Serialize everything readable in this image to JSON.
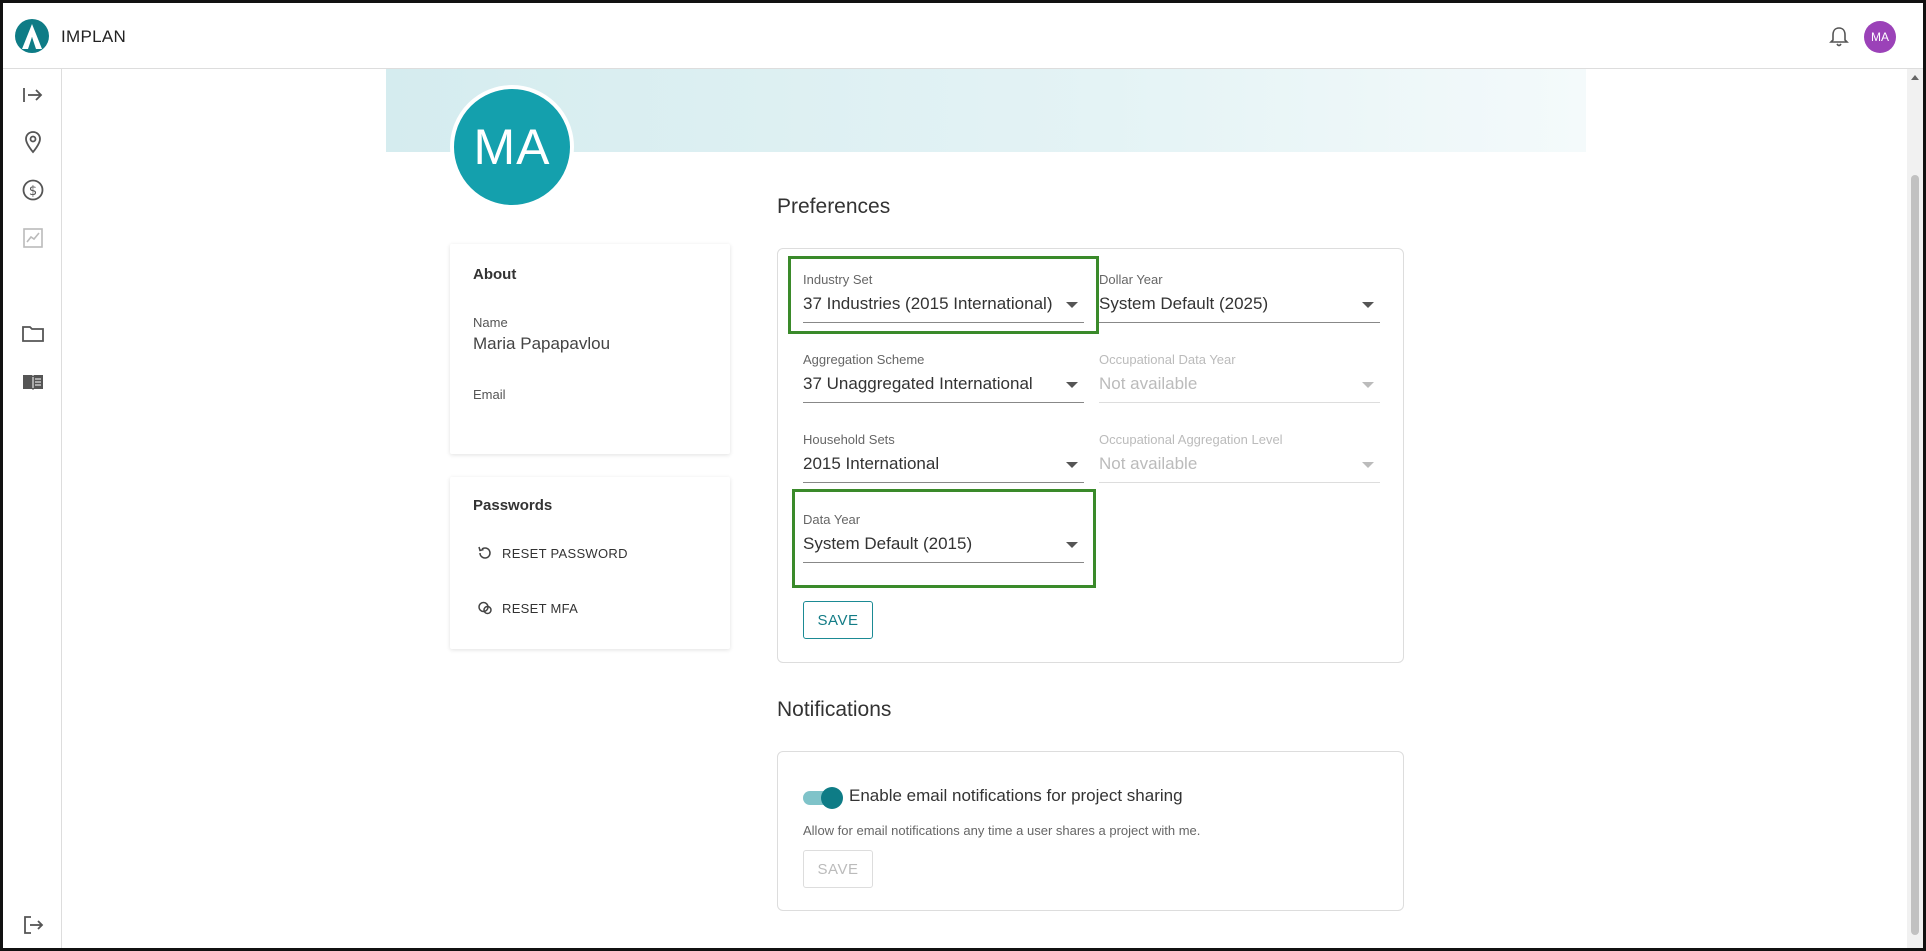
{
  "app": {
    "brand": "IMPLAN",
    "avatar_initials": "MA"
  },
  "sidebar": {
    "items": [
      {
        "icon": "expand-sidebar-icon"
      },
      {
        "icon": "location-pin-icon"
      },
      {
        "icon": "dollar-circle-icon"
      },
      {
        "icon": "chart-icon"
      },
      {
        "icon": "folder-icon"
      },
      {
        "icon": "book-icon"
      },
      {
        "icon": "logout-icon"
      }
    ]
  },
  "profile": {
    "initials": "MA",
    "about": {
      "title": "About",
      "name_label": "Name",
      "name_value": "Maria Papapavlou",
      "email_label": "Email",
      "email_value": ""
    },
    "passwords": {
      "title": "Passwords",
      "reset_password": "RESET PASSWORD",
      "reset_mfa": "RESET MFA"
    }
  },
  "preferences": {
    "title": "Preferences",
    "industry_set": {
      "label": "Industry Set",
      "value": "37 Industries (2015 International)"
    },
    "dollar_year": {
      "label": "Dollar Year",
      "value": "System Default (2025)"
    },
    "aggregation_scheme": {
      "label": "Aggregation Scheme",
      "value": "37 Unaggregated International"
    },
    "occupational_data_year": {
      "label": "Occupational Data Year",
      "value": "Not available"
    },
    "household_sets": {
      "label": "Household Sets",
      "value": "2015 International"
    },
    "occupational_aggregation_level": {
      "label": "Occupational Aggregation Level",
      "value": "Not available"
    },
    "data_year": {
      "label": "Data Year",
      "value": "System Default (2015)"
    },
    "save": "SAVE"
  },
  "notifications": {
    "title": "Notifications",
    "toggle_label": "Enable email notifications for project sharing",
    "toggle_on": true,
    "description": "Allow for email notifications any time a user shares a project with me.",
    "save": "SAVE"
  },
  "colors": {
    "accent": "#0e7c86",
    "avatar_small": "#9b42b8",
    "avatar_large": "#14a0ad",
    "highlight": "#3a8a2a"
  }
}
